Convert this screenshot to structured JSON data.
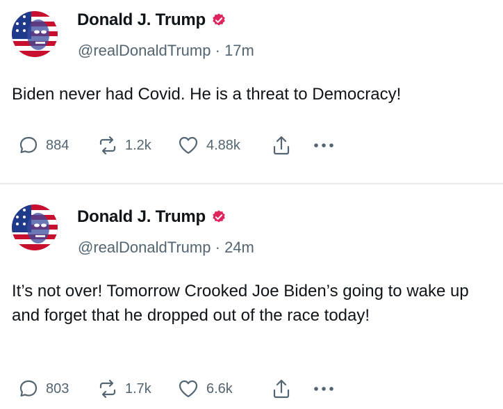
{
  "posts": [
    {
      "author": "Donald J. Trump",
      "handle": "@realDonaldTrump",
      "separator": "·",
      "time": "17m",
      "text": "Biden never had Covid. He is a threat to Democracy!",
      "stats": {
        "replies": "884",
        "reposts": "1.2k",
        "likes": "4.88k"
      }
    },
    {
      "author": "Donald J. Trump",
      "handle": "@realDonaldTrump",
      "separator": "·",
      "time": "24m",
      "text": "It’s not over! Tomorrow Crooked Joe Biden’s going to wake up and forget that he dropped out of the race today!",
      "stats": {
        "replies": "803",
        "reposts": "1.7k",
        "likes": "6.6k"
      }
    }
  ],
  "icons": {
    "verified": "verified-badge-icon",
    "reply": "speech-bubble-icon",
    "repost": "repost-arrows-icon",
    "like": "heart-icon",
    "share": "share-upload-icon",
    "more": "ellipsis-icon"
  },
  "colors": {
    "verified_badge": "#e0245e",
    "secondary_text": "#536471",
    "primary_text": "#0f1419",
    "divider": "#eaeaea"
  }
}
